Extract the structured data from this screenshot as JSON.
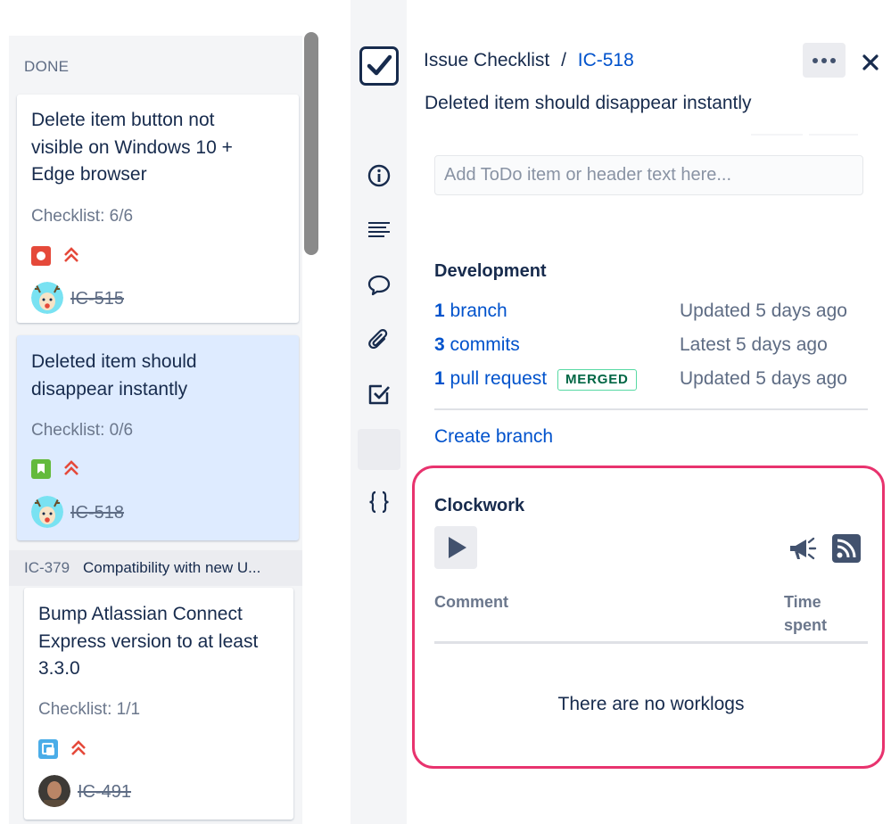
{
  "board": {
    "column_title": "DONE",
    "cards": [
      {
        "title_lines": [
          "Delete item button not",
          "visible on Windows 10 +",
          "Edge browser"
        ],
        "checklist": "Checklist: 6/6",
        "type_icon": "bug-icon",
        "priority_icon": "priority-highest-icon",
        "key": "IC-515"
      },
      {
        "title_lines": [
          "Deleted item should",
          "disappear instantly"
        ],
        "checklist": "Checklist: 0/6",
        "type_icon": "story-icon",
        "priority_icon": "priority-highest-icon",
        "key": "IC-518"
      },
      {
        "title_lines": [
          "Bump Atlassian Connect",
          "Express version to at least",
          "3.3.0"
        ],
        "checklist": "Checklist: 1/1",
        "type_icon": "subtask-icon",
        "priority_icon": "priority-highest-icon",
        "key": "IC-491"
      }
    ],
    "swimlane": {
      "key": "IC-379",
      "name": "Compatibility with new U..."
    }
  },
  "panel": {
    "breadcrumb_app": "Issue Checklist",
    "breadcrumb_sep": "/",
    "breadcrumb_key": "IC-518",
    "summary": "Deleted item should disappear instantly",
    "todo_placeholder": "Add ToDo item or header text here...",
    "development": {
      "title": "Development",
      "rows": [
        {
          "count": "1",
          "label": "branch",
          "status": "Updated 5 days ago"
        },
        {
          "count": "3",
          "label": "commits",
          "status": "Latest 5 days ago"
        },
        {
          "count": "1",
          "label": "pull request",
          "status": "Updated 5 days ago",
          "badge": "MERGED"
        }
      ],
      "create_branch": "Create branch"
    },
    "clockwork": {
      "title": "Clockwork",
      "col_comment": "Comment",
      "col_time_1": "Time",
      "col_time_2": "spent",
      "empty": "There are no worklogs"
    }
  },
  "colors": {
    "link": "#0052cc",
    "highlight_border": "#e8336e",
    "selected_card": "#deebff",
    "merged_green": "#006644"
  }
}
